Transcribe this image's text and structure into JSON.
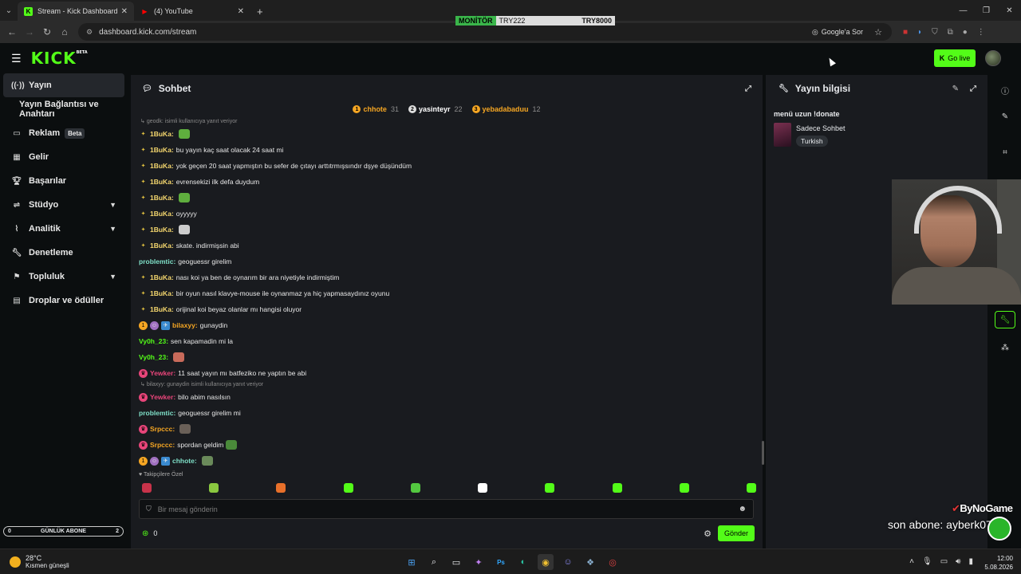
{
  "browser": {
    "tabs": [
      {
        "title": "Stream - Kick Dashboard",
        "fav": "K",
        "fav_color": "#53fc18"
      },
      {
        "title": "(4) YouTube",
        "fav": "▶",
        "fav_color": "#ff0000"
      }
    ],
    "url": "dashboard.kick.com/stream",
    "google_ask": "Google'a Sor"
  },
  "ticker": {
    "label": "MONİTÖR",
    "a": "TRY222",
    "b": "TRY8000"
  },
  "header": {
    "logo": "KICK",
    "logo_sup": "BETA",
    "go_live": "Go live"
  },
  "sidebar": {
    "items": [
      {
        "label": "Yayın",
        "icon": "radio-icon"
      },
      {
        "label": "Yayın Bağlantısı ve Anahtarı"
      },
      {
        "label": "Reklam",
        "badge": "Beta",
        "icon": "ad-icon"
      },
      {
        "label": "Gelir",
        "icon": "income-icon"
      },
      {
        "label": "Başarılar",
        "icon": "trophy-icon"
      },
      {
        "label": "Stüdyo",
        "icon": "studio-icon"
      },
      {
        "label": "Analitik",
        "icon": "analytics-icon"
      },
      {
        "label": "Denetleme",
        "icon": "wrench-icon"
      },
      {
        "label": "Topluluk",
        "icon": "community-icon"
      },
      {
        "label": "Droplar ve ödüller",
        "icon": "drops-icon"
      }
    ],
    "daily_sub": {
      "left": "0",
      "label": "GÜNLÜK ABONE",
      "right": "2"
    }
  },
  "chat": {
    "title": "Sohbet",
    "top_gifters": [
      {
        "name": "chhote",
        "count": "31",
        "color": "#f5a623"
      },
      {
        "name": "yasinteyr",
        "count": "22",
        "color": "#ffffff"
      },
      {
        "name": "yebadabaduu",
        "count": "12",
        "color": "#f5a623"
      }
    ],
    "messages": [
      {
        "reply": "geodk: isimli kullanıcıya yanıt veriyor"
      },
      {
        "user": "1BuKa",
        "color": "#f5d76e",
        "text": "",
        "emote": "#5fae3e"
      },
      {
        "user": "1BuKa",
        "color": "#f5d76e",
        "text": "bu yayın kaç saat olacak 24 saat mi"
      },
      {
        "user": "1BuKa",
        "color": "#f5d76e",
        "text": "yok geçen 20 saat yapmıştın bu sefer de çıtayı arttıtrmışsındır dşye düşündüm"
      },
      {
        "user": "1BuKa",
        "color": "#f5d76e",
        "text": "evrensekizi ilk defa duydum"
      },
      {
        "user": "1BuKa",
        "color": "#f5d76e",
        "text": "",
        "emote": "#5fae3e"
      },
      {
        "user": "1BuKa",
        "color": "#f5d76e",
        "text": "oyyyyy"
      },
      {
        "user": "1BuKa",
        "color": "#f5d76e",
        "text": "",
        "emote": "#cccccc"
      },
      {
        "user": "1BuKa",
        "color": "#f5d76e",
        "text": "skate. indirmişsin abi"
      },
      {
        "user": "problemtic",
        "color": "#7fe0c8",
        "text": "geoguessr girelim",
        "nobadge": true
      },
      {
        "user": "1BuKa",
        "color": "#f5d76e",
        "text": "nası koi ya ben de oynarım bir ara niyetiyle indirmiştim"
      },
      {
        "user": "1BuKa",
        "color": "#f5d76e",
        "text": "bir oyun nasıl klavye-mouse ile oynanmaz ya hiç yapmasaydınız oyunu"
      },
      {
        "user": "1BuKa",
        "color": "#f5d76e",
        "text": "orijinal koi beyaz olanlar mı hangisi oluyor"
      },
      {
        "user": "bilaxyy",
        "color": "#f5a623",
        "text": "gunaydin",
        "multi": true
      },
      {
        "user": "Vy0h_23",
        "color": "#53fc18",
        "text": "sen kapamadin mi la",
        "nobadge": true
      },
      {
        "user": "Vy0h_23",
        "color": "#53fc18",
        "text": "",
        "emote": "#c86a5a",
        "nobadge": true
      },
      {
        "user": "Yewker",
        "color": "#e8457a",
        "text": "11 saat yayın mı batfeziko ne yaptın be abi",
        "pink": true
      },
      {
        "reply": "bilaxyy: gunaydin isimli kullanıcıya yanıt veriyor"
      },
      {
        "user": "Yewker",
        "color": "#e8457a",
        "text": "bilo abim nasılsın",
        "pink": true
      },
      {
        "user": "problemtic",
        "color": "#7fe0c8",
        "text": "geoguessr girelim mi",
        "nobadge": true
      },
      {
        "user": "Srpccc",
        "color": "#f5a623",
        "text": "",
        "emote": "#6a6058",
        "pink": true
      },
      {
        "user": "Srpccc",
        "color": "#f5a623",
        "text": "spordan geldim",
        "emote": "#4a8a3a",
        "pink": true
      },
      {
        "user": "chhote",
        "color": "#7fe0c8",
        "text": "",
        "emote": "#6a8a5a",
        "multi": true
      }
    ],
    "followers_only": "Takipçilere Özel",
    "emote_bar": [
      "#c8334a",
      "#8ac840",
      "#e8702a",
      "#53fc18",
      "#53c840",
      "#ffffff",
      "#53fc18",
      "#53fc18",
      "#53fc18",
      "#53fc18"
    ],
    "input_placeholder": "Bir mesaj gönderin",
    "points": "0",
    "send": "Gönder"
  },
  "stream_info": {
    "title": "Yayın bilgisi",
    "stream_title": "menü uzun !donate",
    "category": "Sadece Sohbet",
    "language": "Turkish"
  },
  "overlay": {
    "brand": "ByNoGame",
    "last_sub": "son abone: ayberk07"
  },
  "taskbar": {
    "temp": "28°C",
    "weather": "Kısmen güneşli",
    "time": "12:00",
    "date": "5.08.2026"
  }
}
